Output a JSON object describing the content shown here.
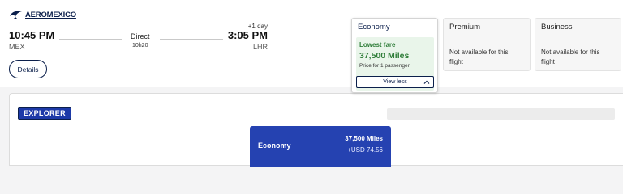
{
  "airline": {
    "name": "AEROMEXICO"
  },
  "flight": {
    "departure_time": "10:45 PM",
    "departure_code": "MEX",
    "stops_label": "Direct",
    "duration": "10h20",
    "day_offset": "+1 day",
    "arrival_time": "3:05 PM",
    "arrival_code": "LHR",
    "details_label": "Details"
  },
  "fares": {
    "economy": {
      "title": "Economy",
      "badge": "Lowest fare",
      "miles": "37,500 Miles",
      "per_passenger": "Price for 1 passenger",
      "toggle_label": "View less"
    },
    "premium": {
      "title": "Premium",
      "status": "Not available for this flight"
    },
    "business": {
      "title": "Business",
      "status": "Not available for this flight"
    }
  },
  "expanded": {
    "badge": "EXPLORER",
    "cabin": "Economy",
    "miles": "37,500 Miles",
    "usd": "+USD 74.56"
  },
  "colors": {
    "brand_navy": "#0b1f4b",
    "accent_blue": "#2542b1",
    "lowest_fare_green": "#2f7d39",
    "lowest_fare_bg": "#e9f5ea"
  }
}
